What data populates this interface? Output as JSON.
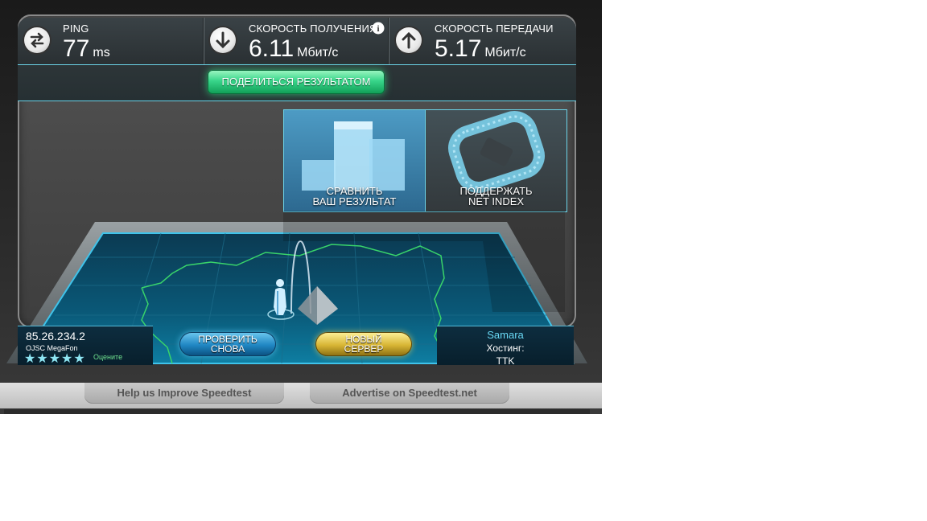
{
  "stats": {
    "ping": {
      "label": "PING",
      "value": "77",
      "unit": "ms"
    },
    "download": {
      "label": "СКОРОСТЬ ПОЛУЧЕНИЯ",
      "value": "6.11",
      "unit": "Мбит/с"
    },
    "upload": {
      "label": "СКОРОСТЬ ПЕРЕДАЧИ",
      "value": "5.17",
      "unit": "Мбит/с"
    }
  },
  "share_label": "ПОДЕЛИТЬСЯ РЕЗУЛЬТАТОМ",
  "tiles": {
    "compare": {
      "line1": "СРАВНИТЬ",
      "line2": "ВАШ РЕЗУЛЬТАТ"
    },
    "support": {
      "line1": "ПОДДЕРЖАТЬ",
      "line2": "NET INDEX"
    }
  },
  "client": {
    "ip": "85.26.234.2",
    "isp": "OJSC MegaFon",
    "rating_stars": "★★★★★",
    "rate_label": "Оцените"
  },
  "buttons": {
    "retest": {
      "line1": "ПРОВЕРИТЬ",
      "line2": "СНОВА"
    },
    "new_server": {
      "line1": "НОВЫЙ",
      "line2": "СЕРВЕР"
    }
  },
  "server": {
    "city": "Samara",
    "hosting_label": "Хостинг:",
    "host": "TTK"
  },
  "footer": {
    "help": "Help us Improve Speedtest",
    "advertise": "Advertise on Speedtest.net"
  },
  "colors": {
    "accent_cyan": "#6bd3e8",
    "share_green": "#38d58a",
    "map_green": "#39d46a",
    "retest_blue": "#1f86c2",
    "new_server_gold": "#d7b534"
  }
}
